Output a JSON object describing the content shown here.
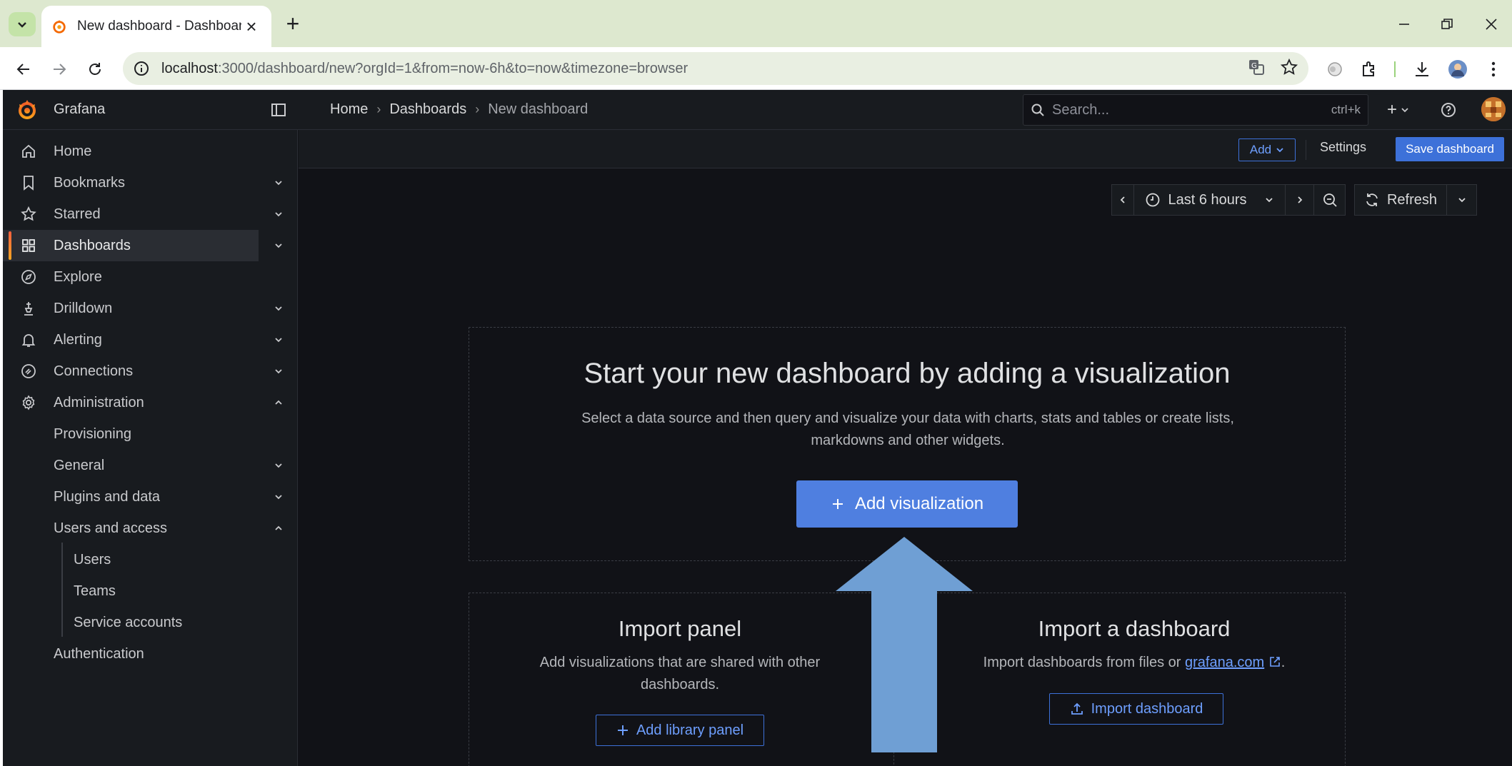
{
  "browser": {
    "tab_title": "New dashboard - Dashboards -",
    "url_host": "localhost",
    "url_rest": ":3000/dashboard/new?orgId=1&from=now-6h&to=now&timezone=browser"
  },
  "grafana": {
    "brand": "Grafana",
    "breadcrumbs": [
      "Home",
      "Dashboards",
      "New dashboard"
    ],
    "search": {
      "placeholder": "Search...",
      "shortcut": "ctrl+k"
    },
    "plus_label": "+"
  },
  "sidebar": {
    "items": [
      {
        "label": "Home",
        "icon": "home-icon",
        "chevron": "none"
      },
      {
        "label": "Bookmarks",
        "icon": "bookmark-icon",
        "chevron": "down"
      },
      {
        "label": "Starred",
        "icon": "star-icon",
        "chevron": "down"
      },
      {
        "label": "Dashboards",
        "icon": "apps-icon",
        "chevron": "down",
        "active": true
      },
      {
        "label": "Explore",
        "icon": "compass-icon",
        "chevron": "none"
      },
      {
        "label": "Drilldown",
        "icon": "drilldown-icon",
        "chevron": "down"
      },
      {
        "label": "Alerting",
        "icon": "bell-icon",
        "chevron": "down"
      },
      {
        "label": "Connections",
        "icon": "connections-icon",
        "chevron": "down"
      },
      {
        "label": "Administration",
        "icon": "cog-icon",
        "chevron": "up"
      }
    ],
    "admin_children": [
      {
        "label": "Provisioning",
        "chevron": "none"
      },
      {
        "label": "General",
        "chevron": "down"
      },
      {
        "label": "Plugins and data",
        "chevron": "down"
      },
      {
        "label": "Users and access",
        "chevron": "up"
      }
    ],
    "users_children": [
      "Users",
      "Teams",
      "Service accounts"
    ],
    "authentication": "Authentication"
  },
  "dashboard_toolbar": {
    "add_label": "Add",
    "settings_label": "Settings",
    "save_label": "Save dashboard"
  },
  "time_picker": {
    "range_label": "Last 6 hours",
    "refresh_label": "Refresh"
  },
  "empty_state": {
    "title": "Start your new dashboard by adding a visualization",
    "description": "Select a data source and then query and visualize your data with charts, stats and tables or create lists, markdowns and other widgets.",
    "button_label": "Add visualization"
  },
  "import_panel": {
    "title": "Import panel",
    "description": "Add visualizations that are shared with other dashboards.",
    "button_label": "Add library panel"
  },
  "import_dashboard": {
    "title": "Import a dashboard",
    "description_prefix": "Import dashboards from files or ",
    "link_text": "grafana.com",
    "description_suffix": ".",
    "button_label": "Import dashboard"
  },
  "colors": {
    "accent": "#3d71d9",
    "page_bg": "#111217",
    "panel_bg": "#181b1f",
    "arrow_overlay": "#6f9fd4"
  }
}
